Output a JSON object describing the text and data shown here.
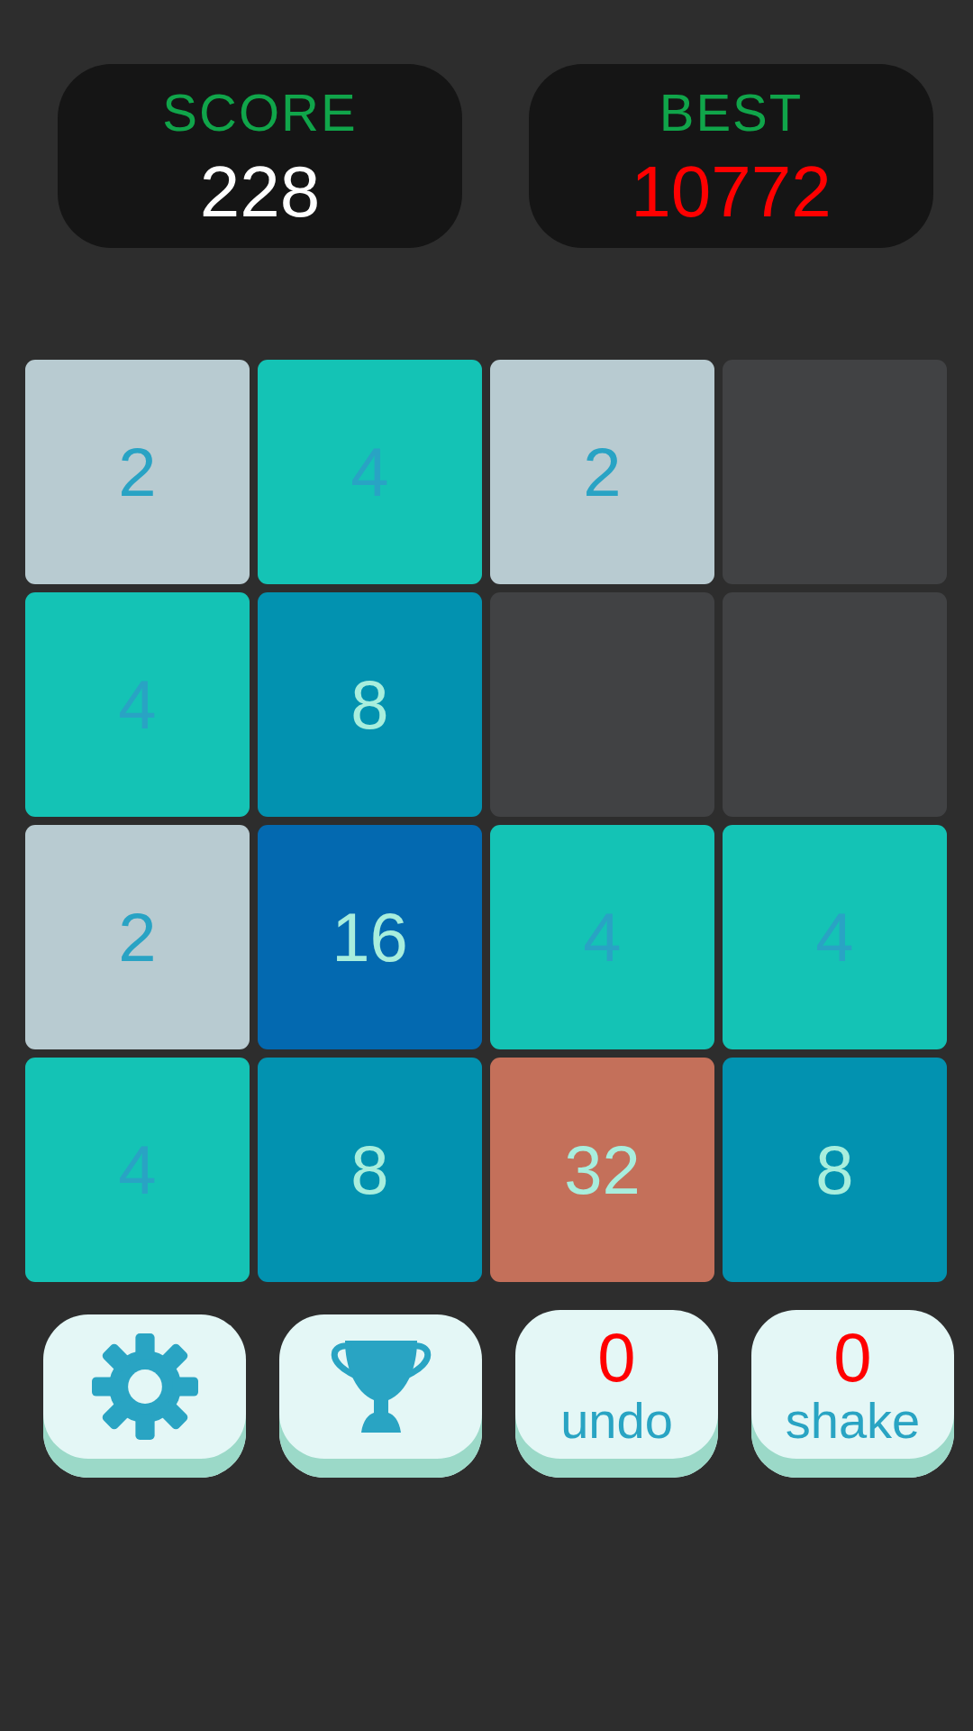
{
  "scoreboard": [
    {
      "kind": "score",
      "label": "SCORE",
      "value": "228"
    },
    {
      "kind": "best",
      "label": "BEST",
      "value": "10772"
    }
  ],
  "board": {
    "rows": [
      [
        {
          "kind": "light",
          "value": "2",
          "color": "#b8cbd1"
        },
        {
          "kind": "light",
          "value": "4",
          "color": "#14c3b5"
        },
        {
          "kind": "light",
          "value": "2",
          "color": "#b8cbd1"
        },
        {
          "kind": "empty"
        }
      ],
      [
        {
          "kind": "light",
          "value": "4",
          "color": "#14c3b5"
        },
        {
          "kind": "dark",
          "value": "8",
          "color": "#0292b0"
        },
        {
          "kind": "empty"
        },
        {
          "kind": "empty"
        }
      ],
      [
        {
          "kind": "light",
          "value": "2",
          "color": "#b8cbd1"
        },
        {
          "kind": "dark",
          "value": "16",
          "color": "#0369b0"
        },
        {
          "kind": "light",
          "value": "4",
          "color": "#14c3b5"
        },
        {
          "kind": "light",
          "value": "4",
          "color": "#14c3b5"
        }
      ],
      [
        {
          "kind": "light",
          "value": "4",
          "color": "#14c3b5"
        },
        {
          "kind": "dark",
          "value": "8",
          "color": "#0292b0"
        },
        {
          "kind": "dark",
          "value": "32",
          "color": "#c4705a"
        },
        {
          "kind": "dark",
          "value": "8",
          "color": "#0292b0"
        }
      ]
    ]
  },
  "toolbar": {
    "buttons": [
      {
        "kind": "settings"
      },
      {
        "kind": "awards"
      },
      {
        "kind": "counter",
        "count": "0",
        "label": "undo"
      },
      {
        "kind": "counter",
        "count": "0",
        "label": "shake"
      }
    ]
  }
}
